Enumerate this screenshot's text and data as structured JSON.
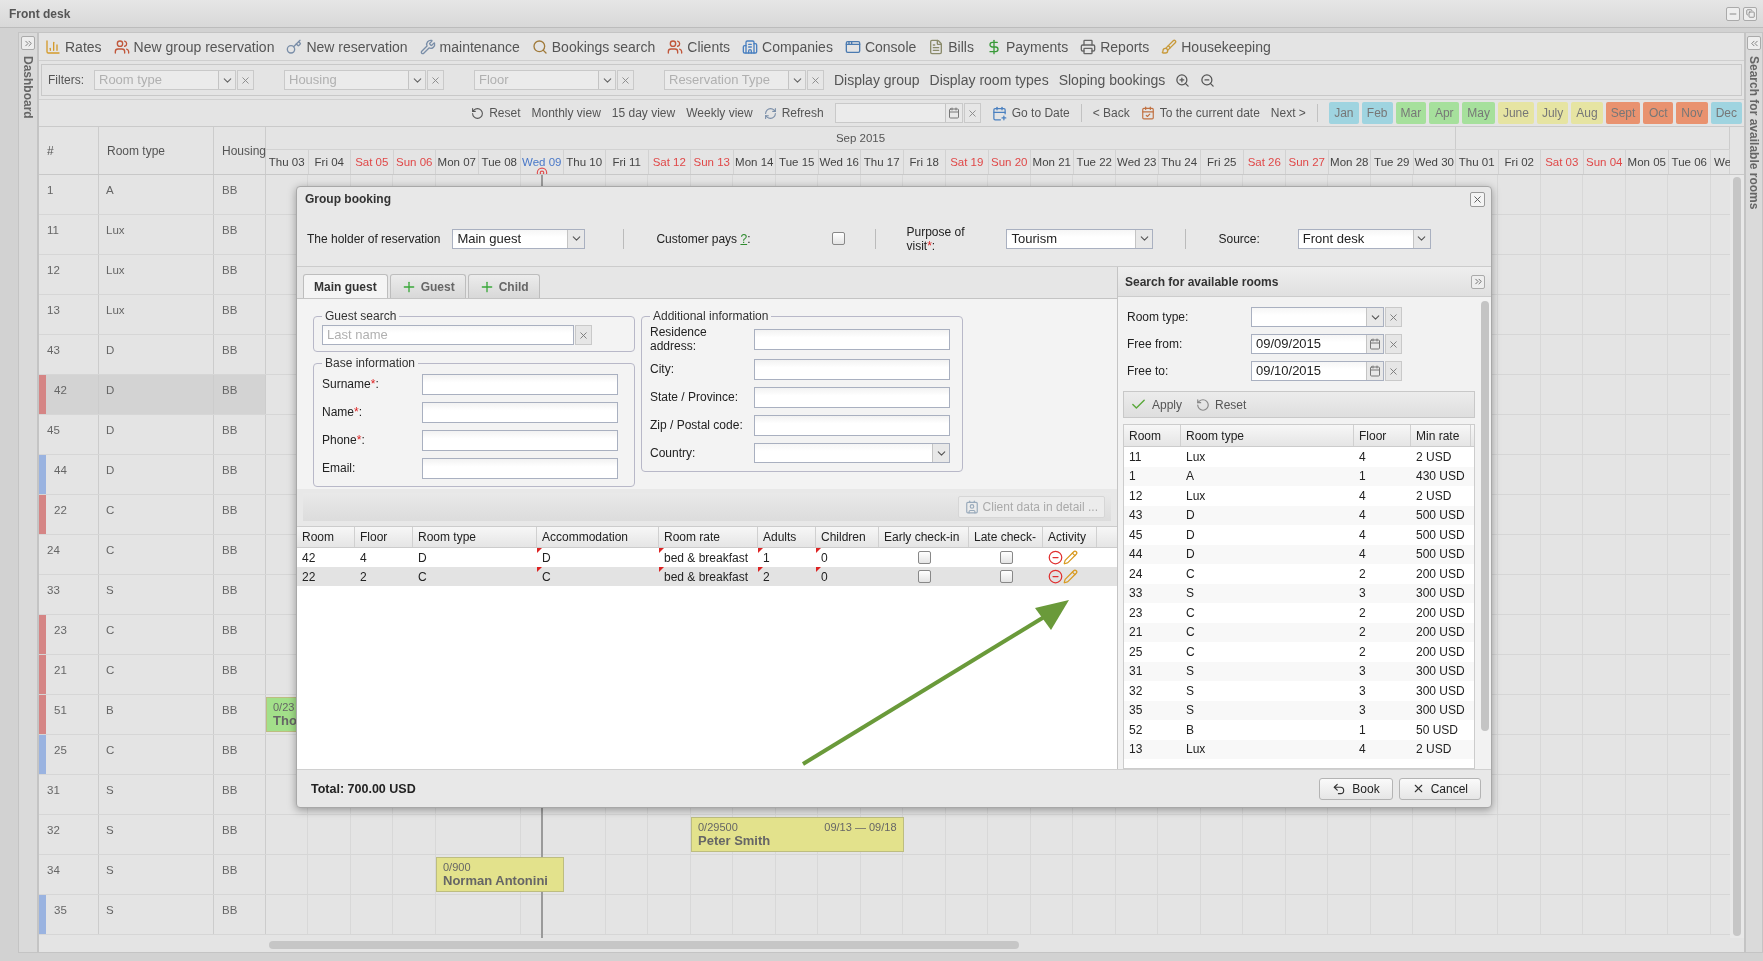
{
  "window": {
    "title": "Front desk"
  },
  "left_sidebar": {
    "label": "Dashboard"
  },
  "right_sidebar": {
    "label": "Search for available rooms"
  },
  "toolbar": [
    {
      "label": "Rates"
    },
    {
      "label": "New group reservation"
    },
    {
      "label": "New reservation"
    },
    {
      "label": "maintenance"
    },
    {
      "label": "Bookings search"
    },
    {
      "label": "Clients"
    },
    {
      "label": "Companies"
    },
    {
      "label": "Console"
    },
    {
      "label": "Bills"
    },
    {
      "label": "Payments"
    },
    {
      "label": "Reports"
    },
    {
      "label": "Housekeeping"
    }
  ],
  "filters": {
    "label": "Filters:",
    "dropdowns": [
      {
        "placeholder": "Room type"
      },
      {
        "placeholder": "Housing"
      },
      {
        "placeholder": "Floor"
      },
      {
        "placeholder": "Reservation Type"
      }
    ],
    "buttons": [
      {
        "label": "Display group"
      },
      {
        "label": "Display room types"
      },
      {
        "label": "Sloping bookings"
      }
    ]
  },
  "nav": {
    "reset": "Reset",
    "views": [
      {
        "label": "Monthly view"
      },
      {
        "label": "15 day view"
      },
      {
        "label": "Weekly view"
      }
    ],
    "refresh": "Refresh",
    "go_to_date": "Go to Date",
    "back": "< Back",
    "current_date": "To the current date",
    "next": "Next >",
    "months": [
      {
        "label": "Jan",
        "color": "#9fd4e0"
      },
      {
        "label": "Feb",
        "color": "#9fd4e0"
      },
      {
        "label": "Mar",
        "color": "#a6e09c"
      },
      {
        "label": "Apr",
        "color": "#a6e09c"
      },
      {
        "label": "May",
        "color": "#a6e09c"
      },
      {
        "label": "June",
        "color": "#e6e4a2"
      },
      {
        "label": "July",
        "color": "#e6e4a2"
      },
      {
        "label": "Aug",
        "color": "#e6e4a2"
      },
      {
        "label": "Sept",
        "color": "#e9926f"
      },
      {
        "label": "Oct",
        "color": "#e9926f"
      },
      {
        "label": "Nov",
        "color": "#e9926f"
      },
      {
        "label": "Dec",
        "color": "#9fd4e0"
      }
    ]
  },
  "grid": {
    "columns": [
      {
        "label": "#"
      },
      {
        "label": "Room type"
      },
      {
        "label": "Housing"
      }
    ],
    "month_groups": [
      {
        "label": "Sep 2015",
        "days": [
          {
            "label": "Thu 03",
            "kind": "weekday"
          },
          {
            "label": "Fri 04",
            "kind": "weekday"
          },
          {
            "label": "Sat 05",
            "kind": "weekend"
          },
          {
            "label": "Sun 06",
            "kind": "weekend"
          },
          {
            "label": "Mon 07",
            "kind": "weekday"
          },
          {
            "label": "Tue 08",
            "kind": "weekday"
          },
          {
            "label": "Wed 09",
            "kind": "today"
          },
          {
            "label": "Thu 10",
            "kind": "weekday"
          },
          {
            "label": "Fri 11",
            "kind": "weekday"
          },
          {
            "label": "Sat 12",
            "kind": "weekend"
          },
          {
            "label": "Sun 13",
            "kind": "weekend"
          },
          {
            "label": "Mon 14",
            "kind": "weekday"
          },
          {
            "label": "Tue 15",
            "kind": "weekday"
          },
          {
            "label": "Wed 16",
            "kind": "weekday"
          },
          {
            "label": "Thu 17",
            "kind": "weekday"
          },
          {
            "label": "Fri 18",
            "kind": "weekday"
          },
          {
            "label": "Sat 19",
            "kind": "weekend"
          },
          {
            "label": "Sun 20",
            "kind": "weekend"
          },
          {
            "label": "Mon 21",
            "kind": "weekday"
          },
          {
            "label": "Tue 22",
            "kind": "weekday"
          },
          {
            "label": "Wed 23",
            "kind": "weekday"
          },
          {
            "label": "Thu 24",
            "kind": "weekday"
          },
          {
            "label": "Fri 25",
            "kind": "weekday"
          },
          {
            "label": "Sat 26",
            "kind": "weekend"
          },
          {
            "label": "Sun 27",
            "kind": "weekend"
          },
          {
            "label": "Mon 28",
            "kind": "weekday"
          },
          {
            "label": "Tue 29",
            "kind": "weekday"
          },
          {
            "label": "Wed 30",
            "kind": "weekday"
          }
        ]
      },
      {
        "days": [
          {
            "label": "Thu 01",
            "kind": "weekday"
          },
          {
            "label": "Fri 02",
            "kind": "weekday"
          },
          {
            "label": "Sat 03",
            "kind": "weekend"
          },
          {
            "label": "Sun 04",
            "kind": "weekend"
          },
          {
            "label": "Mon 05",
            "kind": "weekday"
          },
          {
            "label": "Tue 06",
            "kind": "weekday"
          },
          {
            "label": "We",
            "kind": "weekday"
          }
        ]
      }
    ],
    "rows": [
      {
        "number": "1",
        "room_type": "A",
        "housing": "BB",
        "selected": false
      },
      {
        "number": "11",
        "room_type": "Lux",
        "housing": "BB",
        "selected": false
      },
      {
        "number": "12",
        "room_type": "Lux",
        "housing": "BB",
        "selected": false
      },
      {
        "number": "13",
        "room_type": "Lux",
        "housing": "BB",
        "selected": false
      },
      {
        "number": "43",
        "room_type": "D",
        "housing": "BB",
        "selected": false
      },
      {
        "number": "42",
        "room_type": "D",
        "housing": "BB",
        "selected": true,
        "color": "#d58585"
      },
      {
        "number": "45",
        "room_type": "D",
        "housing": "BB",
        "selected": false
      },
      {
        "number": "44",
        "room_type": "D",
        "housing": "BB",
        "selected": false,
        "color": "#9ab3e0"
      },
      {
        "number": "22",
        "room_type": "C",
        "housing": "BB",
        "selected": false,
        "color": "#d58585"
      },
      {
        "number": "24",
        "room_type": "C",
        "housing": "BB",
        "selected": false
      },
      {
        "number": "33",
        "room_type": "S",
        "housing": "BB",
        "selected": false
      },
      {
        "number": "23",
        "room_type": "C",
        "housing": "BB",
        "selected": false,
        "color": "#d58585"
      },
      {
        "number": "21",
        "room_type": "C",
        "housing": "BB",
        "selected": false,
        "color": "#d58585"
      },
      {
        "number": "51",
        "room_type": "B",
        "housing": "BB",
        "selected": false,
        "color": "#d58585",
        "bookings": [
          {
            "amount": "0/23",
            "guest": "Tho",
            "color": "#a3e08a"
          }
        ]
      },
      {
        "number": "25",
        "room_type": "C",
        "housing": "BB",
        "selected": false,
        "color": "#9ab3e0"
      },
      {
        "number": "31",
        "room_type": "S",
        "housing": "BB",
        "selected": false
      },
      {
        "number": "32",
        "room_type": "S",
        "housing": "BB",
        "selected": false,
        "bookings": [
          {
            "amount": "0/29500",
            "dates": "09/13 — 09/18",
            "guest": "Peter Smith",
            "color": "#e3e28c"
          }
        ]
      },
      {
        "number": "34",
        "room_type": "S",
        "housing": "BB",
        "selected": false,
        "bookings": [
          {
            "amount": "0/900",
            "guest": "Norman Antonini",
            "color": "#e3e28c"
          }
        ]
      },
      {
        "number": "35",
        "room_type": "S",
        "housing": "BB",
        "selected": false,
        "color": "#9ab3e0"
      }
    ]
  },
  "dialog": {
    "title": "Group booking",
    "holder": {
      "label": "The holder of reservation",
      "value": "Main guest"
    },
    "customer_pays": {
      "label": "Customer pays ",
      "link": "?",
      "suffix": ":",
      "checked": false
    },
    "purpose": {
      "label": "Purpose of visit",
      "required_mark": "*",
      "suffix": ":",
      "value": "Tourism"
    },
    "source": {
      "label": "Source:",
      "value": "Front desk"
    },
    "tabs": [
      {
        "label": "Main guest",
        "selected": true,
        "kind": "plain"
      },
      {
        "label": "Guest",
        "selected": false,
        "kind": "add"
      },
      {
        "label": "Child",
        "selected": false,
        "kind": "add"
      }
    ],
    "guest_search": {
      "legend": "Guest search",
      "placeholder": "Last name"
    },
    "base_info": {
      "legend": "Base information",
      "fields": [
        {
          "label": "Surname",
          "required_mark": "*",
          "suffix": ":"
        },
        {
          "label": "Name",
          "required_mark": "*",
          "suffix": ":"
        },
        {
          "label": "Phone",
          "required_mark": "*",
          "suffix": ":"
        },
        {
          "label": "Email:"
        }
      ]
    },
    "additional_info": {
      "legend": "Additional information",
      "fields": [
        {
          "label": "Residence address:",
          "kind": "text"
        },
        {
          "label": "City:",
          "kind": "text"
        },
        {
          "label": "State / Province:",
          "kind": "text"
        },
        {
          "label": "Zip / Postal code:",
          "kind": "text"
        },
        {
          "label": "Country:",
          "kind": "combo"
        }
      ]
    },
    "client_data_button": {
      "label": "Client data in detail ...",
      "disabled": true
    },
    "table": {
      "columns": [
        {
          "label": "Room"
        },
        {
          "label": "Floor"
        },
        {
          "label": "Room type"
        },
        {
          "label": "Accommodation",
          "editable": true
        },
        {
          "label": "Room rate",
          "editable": true
        },
        {
          "label": "Adults",
          "editable": true
        },
        {
          "label": "Children",
          "editable": true
        },
        {
          "label": "Early check-in"
        },
        {
          "label": "Late check-"
        },
        {
          "label": "Activity"
        }
      ],
      "rows": [
        {
          "cells": [
            "42",
            "4",
            "D",
            "D",
            "bed & breakfast",
            "1",
            "0"
          ],
          "early_checkin": false,
          "late_checkout": false,
          "selected": false
        },
        {
          "cells": [
            "22",
            "2",
            "C",
            "C",
            "bed & breakfast",
            "2",
            "0"
          ],
          "early_checkin": false,
          "late_checkout": false,
          "selected": true
        }
      ]
    },
    "total": {
      "label": "Total:",
      "value": "700.00 USD"
    },
    "buttons": [
      {
        "label": "Book",
        "kind": "book"
      },
      {
        "label": "Cancel",
        "kind": "cancel"
      }
    ]
  },
  "room_search": {
    "title": "Search for available rooms",
    "fields": [
      {
        "label": "Room type:",
        "kind": "combo"
      },
      {
        "label": "Free from:",
        "kind": "date",
        "value": "09/09/2015"
      },
      {
        "label": "Free to:",
        "kind": "date",
        "value": "09/10/2015"
      }
    ],
    "buttons": [
      {
        "label": "Apply",
        "kind": "apply"
      },
      {
        "label": "Reset",
        "kind": "reset"
      }
    ],
    "table": {
      "columns": [
        {
          "label": "Room"
        },
        {
          "label": "Room type"
        },
        {
          "label": "Floor"
        },
        {
          "label": "Min rate"
        }
      ],
      "rows": [
        [
          "11",
          "Lux",
          "4",
          "2 USD"
        ],
        [
          "1",
          "A",
          "1",
          "430 USD"
        ],
        [
          "12",
          "Lux",
          "4",
          "2 USD"
        ],
        [
          "43",
          "D",
          "4",
          "500 USD"
        ],
        [
          "45",
          "D",
          "4",
          "500 USD"
        ],
        [
          "44",
          "D",
          "4",
          "500 USD"
        ],
        [
          "24",
          "C",
          "2",
          "200 USD"
        ],
        [
          "33",
          "S",
          "3",
          "300 USD"
        ],
        [
          "23",
          "C",
          "2",
          "200 USD"
        ],
        [
          "21",
          "C",
          "2",
          "200 USD"
        ],
        [
          "25",
          "C",
          "2",
          "200 USD"
        ],
        [
          "31",
          "S",
          "3",
          "300 USD"
        ],
        [
          "32",
          "S",
          "3",
          "300 USD"
        ],
        [
          "35",
          "S",
          "3",
          "300 USD"
        ],
        [
          "52",
          "B",
          "1",
          "50 USD"
        ],
        [
          "13",
          "Lux",
          "4",
          "2 USD"
        ]
      ]
    }
  }
}
